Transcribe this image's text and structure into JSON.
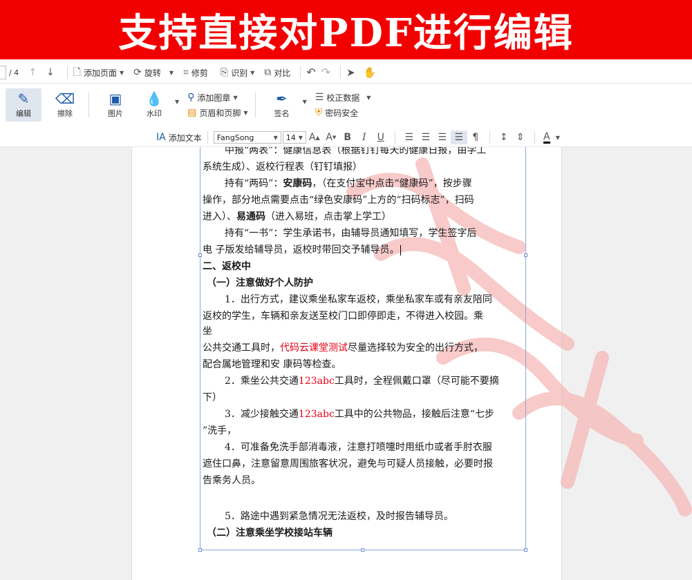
{
  "banner": {
    "title": "支持直接对PDF进行编辑"
  },
  "toolbar1": {
    "page_indicator": "/ 4",
    "add_page": "添加页面",
    "rotate": "旋转",
    "crop": "修剪",
    "recognize": "识别",
    "compare": "对比"
  },
  "toolbar2": {
    "edit": "编辑",
    "erase": "擦除",
    "image": "图片",
    "watermark": "水印",
    "add_stamp": "添加图章",
    "header_footer": "页眉和页脚",
    "signature": "签名",
    "correct_data": "校正数据",
    "password_security": "密码安全"
  },
  "toolbar3": {
    "add_text": "添加文本",
    "font_name": "FangSong",
    "font_size": "14"
  },
  "doc": {
    "l0": "中报“两表”：健康信息表（根据钉钉每天的健康日报，由学工",
    "l1": "系统生成）、返校行程表（钉钉填报）",
    "l2a": "持有“两码”：",
    "l2b": "安康码",
    "l2c": "，（在支付宝中点击“健康码”，按步骤",
    "l3": "操作，部分地点需要点击“绿色安康码”上方的“扫码标志”，扫码",
    "l4a": "进入）、",
    "l4b": "易通码",
    "l4c": "（进入易班，点击掌上学工）",
    "l5": "持有“一书”：学生承诺书，由辅导员通知填写，学生签字后",
    "l6": "电 子版发给辅导员，返校时带回交予辅导员。",
    "l7": "二、返校中",
    "l8": "（一）注意做好个人防护",
    "l9": "1．出行方式，建议乘坐私家车返校，乘坐私家车或有亲友陪同",
    "l10": "返校的学生，车辆和亲友送至校门口即停即走，不得进入校园。乘",
    "l11": "坐",
    "l12a": "公共交通工具时，",
    "l12b": "代码云课堂测试",
    "l12c": "尽量选择较为安全的出行方式，",
    "l13": "配合属地管理和安 康码等检查。",
    "l14a": "2．乘坐公共交通",
    "l14b": "123abc",
    "l14c": "工具时，全程佩戴口罩（尽可能不要摘",
    "l15": "下）",
    "l16a": "3．减少接触交通",
    "l16b": "123abc",
    "l16c": "工具中的公共物品，接触后注意“七步",
    "l17": "”洗手，",
    "l18": "4．可准备免洗手部消毒液，注意打喷嚏时用纸巾或者手肘衣服",
    "l19": "遮住口鼻，注意留意周围旅客状况，避免与可疑人员接触，必要时报",
    "l20": "告乘务人员。",
    "l21": "5．路途中遇到紧急情况无法返校，及时报告辅导员。",
    "l22": "（二）注意乘坐学校接站车辆"
  }
}
